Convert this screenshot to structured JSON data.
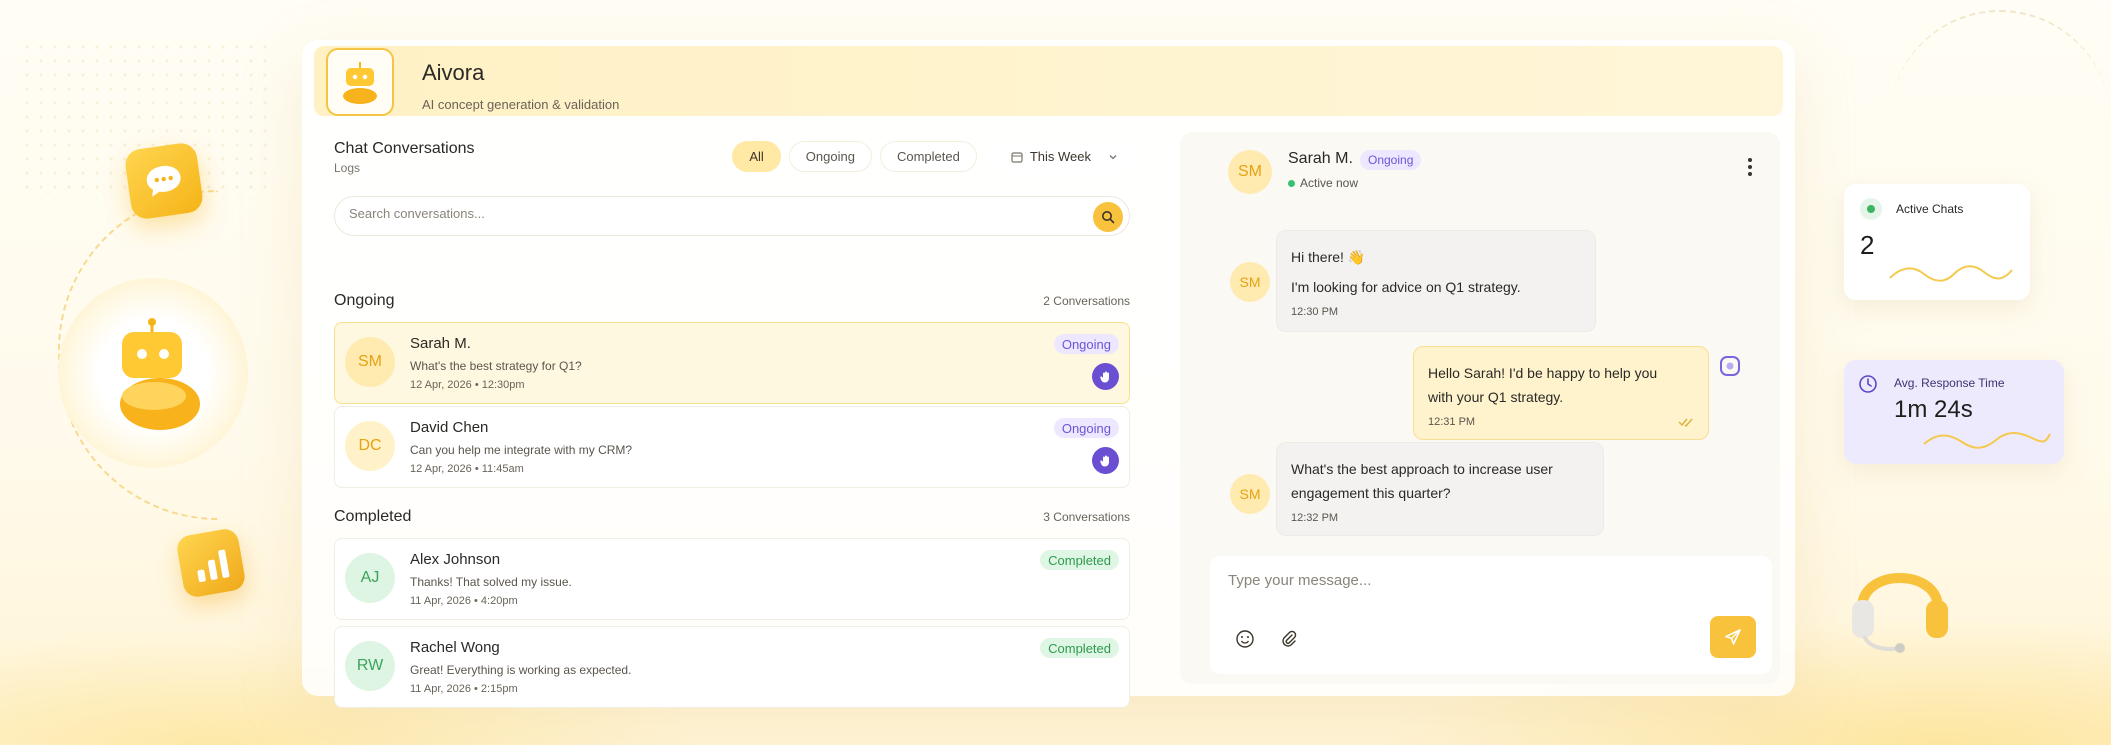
{
  "app": {
    "title": "Aivora",
    "subtitle": "AI concept generation & validation"
  },
  "conversations_panel": {
    "title": "Chat Conversations",
    "subtitle": "Logs",
    "filters": [
      "All",
      "Ongoing",
      "Completed"
    ],
    "active_filter": "All",
    "date_range": "This Week",
    "search_placeholder": "Search conversations..."
  },
  "sections": {
    "ongoing": {
      "title": "Ongoing",
      "count": "2 Conversations",
      "items": [
        {
          "initials": "SM",
          "name": "Sarah M.",
          "message": "What's the best strategy for Q1?",
          "time": "12 Apr, 2026 • 12:30pm",
          "status": "Ongoing"
        },
        {
          "initials": "DC",
          "name": "David Chen",
          "message": "Can you help me integrate with my CRM?",
          "time": "12 Apr, 2026 • 11:45am",
          "status": "Ongoing"
        }
      ]
    },
    "completed": {
      "title": "Completed",
      "count": "3 Conversations",
      "items": [
        {
          "initials": "AJ",
          "name": "Alex Johnson",
          "message": "Thanks! That solved my issue.",
          "time": "11 Apr, 2026 • 4:20pm",
          "status": "Completed"
        },
        {
          "initials": "RW",
          "name": "Rachel Wong",
          "message": "Great! Everything is working as expected.",
          "time": "11 Apr, 2026 • 2:15pm",
          "status": "Completed"
        }
      ]
    }
  },
  "chat": {
    "contact_initials": "SM",
    "contact_name": "Sarah M.",
    "contact_status_badge": "Ongoing",
    "presence": "Active now",
    "messages": [
      {
        "from": "user",
        "lines": [
          "Hi there! 👋",
          "I'm looking for advice on Q1 strategy."
        ],
        "time": "12:30 PM"
      },
      {
        "from": "bot",
        "lines": [
          "Hello Sarah! I'd be happy to help you",
          "with your Q1 strategy."
        ],
        "time": "12:31 PM"
      },
      {
        "from": "user",
        "lines": [
          "What's the best approach to increase user",
          "engagement this quarter?"
        ],
        "time": "12:32 PM"
      }
    ],
    "composer_placeholder": "Type your message..."
  },
  "stats": {
    "active_chats": {
      "label": "Active Chats",
      "value": "2"
    },
    "response_time": {
      "label": "Avg. Response Time",
      "value": "1m 24s"
    }
  },
  "colors": {
    "accent": "#f8c23c",
    "ongoing_badge": "#6b56d6",
    "completed_badge": "#2f9a4f",
    "handoff": "#6a4fd3"
  }
}
